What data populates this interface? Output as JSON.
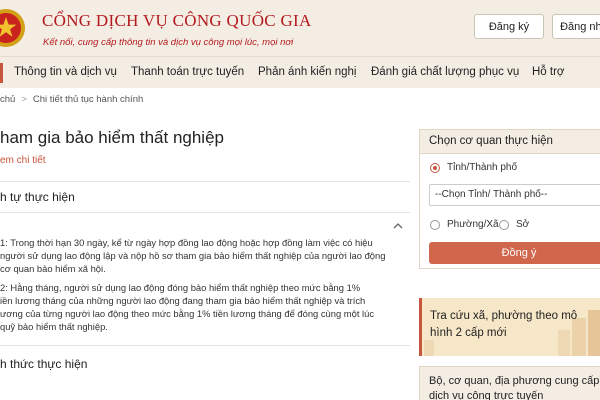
{
  "header": {
    "title": "CỔNG DỊCH VỤ CÔNG QUỐC GIA",
    "subtitle": "Kết nối, cung cấp thông tin và dịch vụ công mọi lúc, mọi nơi",
    "register_label": "Đăng ký",
    "login_label": "Đăng nhập"
  },
  "nav": {
    "items": [
      {
        "label": "Thông tin và dịch vụ"
      },
      {
        "label": "Thanh toán trực tuyến"
      },
      {
        "label": "Phản ánh kiến nghị"
      },
      {
        "label": "Đánh giá chất lượng phục vụ"
      },
      {
        "label": "Hỗ trợ"
      }
    ]
  },
  "breadcrumb": {
    "home": "chủ",
    "current": "Chi tiết thủ tục hành chính"
  },
  "main": {
    "title": "ham gia bảo hiểm thất nghiệp",
    "view_detail": "em chi tiết",
    "section1": "h tự thực hiện",
    "step1": [
      " 1: Trong thời hạn 30 ngày, kể từ ngày hợp đồng lao động hoặc hợp đồng làm việc có hiệu",
      " người sử dụng lao động lập và nộp hồ sơ tham gia bảo hiểm thất nghiệp của người lao động",
      " cơ quan bảo hiểm xã hội."
    ],
    "step2": [
      " 2: Hằng tháng, người sử dụng lao động đóng bảo hiểm thất nghiệp theo mức bằng 1%",
      "iền lương tháng của những người lao động đang tham gia bảo hiểm thất nghiệp và trích",
      "ương của từng người lao động theo mức bằng 1% tiền lương tháng để đóng cùng một lúc",
      "quỹ bảo hiểm thất nghiệp."
    ],
    "section2": "h thức thực hiện"
  },
  "sidebar": {
    "agency_title": "Chọn cơ quan thực hiện",
    "province_label": "Tỉnh/Thành phố",
    "province_select": "--Chọn Tỉnh/ Thành phố--",
    "ward_label": "Phường/Xã",
    "dept_label": "Sở",
    "agree_label": "Đồng ý",
    "promo_text": "Tra cứu xã, phường theo mô hình 2 cấp mới",
    "agency_info": "Bộ, cơ quan, địa phương cung cấp dịch vụ công trực tuyến"
  },
  "colors": {
    "brand_red": "#b4191f",
    "accent": "#c8553d",
    "header_bg": "#f3ede3"
  }
}
